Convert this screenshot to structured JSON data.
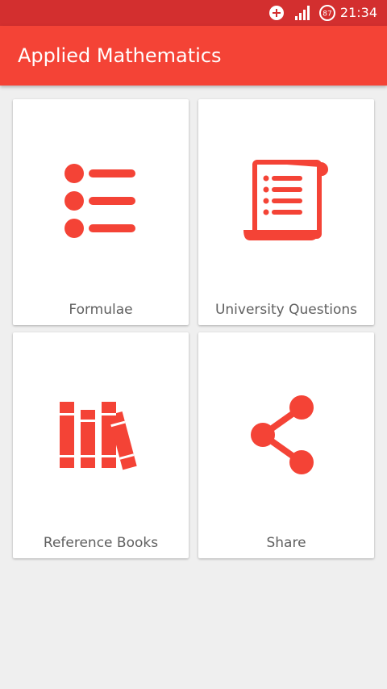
{
  "status_bar": {
    "time": "21:34",
    "battery_level": "87",
    "icons": [
      "add-circle-icon",
      "signal-icon",
      "battery-icon"
    ]
  },
  "app_bar": {
    "title": "Applied Mathematics"
  },
  "menu": {
    "items": [
      {
        "label": "Formulae",
        "icon": "list-icon"
      },
      {
        "label": "University Questions",
        "icon": "scroll-icon"
      },
      {
        "label": "Reference Books",
        "icon": "books-icon"
      },
      {
        "label": "Share",
        "icon": "share-icon"
      }
    ]
  },
  "colors": {
    "status_bar": "#d32f2f",
    "app_bar": "#f44336",
    "accent": "#f44336",
    "background": "#efefef",
    "card": "#ffffff",
    "label_text": "#5f5f5f"
  }
}
